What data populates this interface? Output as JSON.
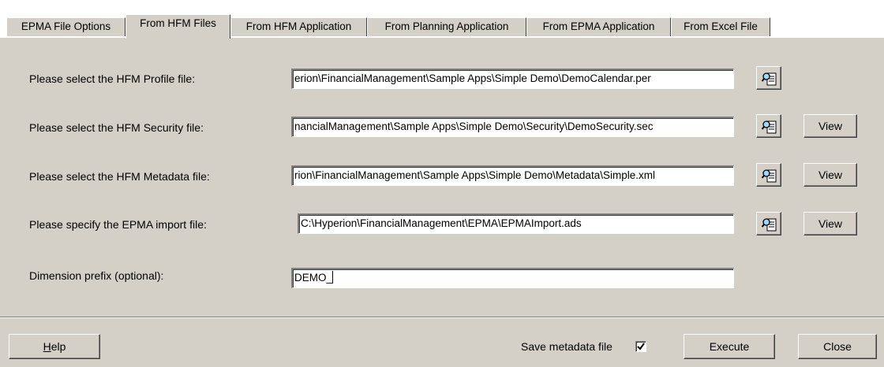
{
  "tabs": [
    {
      "label": "EPMA File Options"
    },
    {
      "label": "From HFM Files"
    },
    {
      "label": "From HFM Application"
    },
    {
      "label": "From Planning Application"
    },
    {
      "label": "From EPMA Application"
    },
    {
      "label": "From Excel File"
    }
  ],
  "active_tab": "From HFM Files",
  "form": {
    "profile": {
      "label": "Please select the HFM Profile file:",
      "value": "erion\\FinancialManagement\\Sample Apps\\Simple Demo\\DemoCalendar.per"
    },
    "security": {
      "label": "Please select the HFM Security file:",
      "value": "nancialManagement\\Sample Apps\\Simple Demo\\Security\\DemoSecurity.sec",
      "view_label": "View"
    },
    "metadata": {
      "label": "Please select the HFM Metadata file:",
      "value": "rion\\FinancialManagement\\Sample Apps\\Simple Demo\\Metadata\\Simple.xml",
      "view_label": "View"
    },
    "epma_import": {
      "label": "Please specify the EPMA import file:",
      "value": "C:\\Hyperion\\FinancialManagement\\EPMA\\EPMAImport.ads",
      "view_label": "View"
    },
    "prefix": {
      "label": "Dimension prefix (optional):",
      "value": "DEMO_"
    }
  },
  "footer": {
    "help_rest": "elp",
    "help_mnemonic": "H",
    "save_metadata_label": "Save metadata file",
    "save_metadata_checked": true,
    "execute_label": "Execute",
    "close_label": "Close"
  },
  "icons": {
    "browse": "browse-file-icon"
  }
}
